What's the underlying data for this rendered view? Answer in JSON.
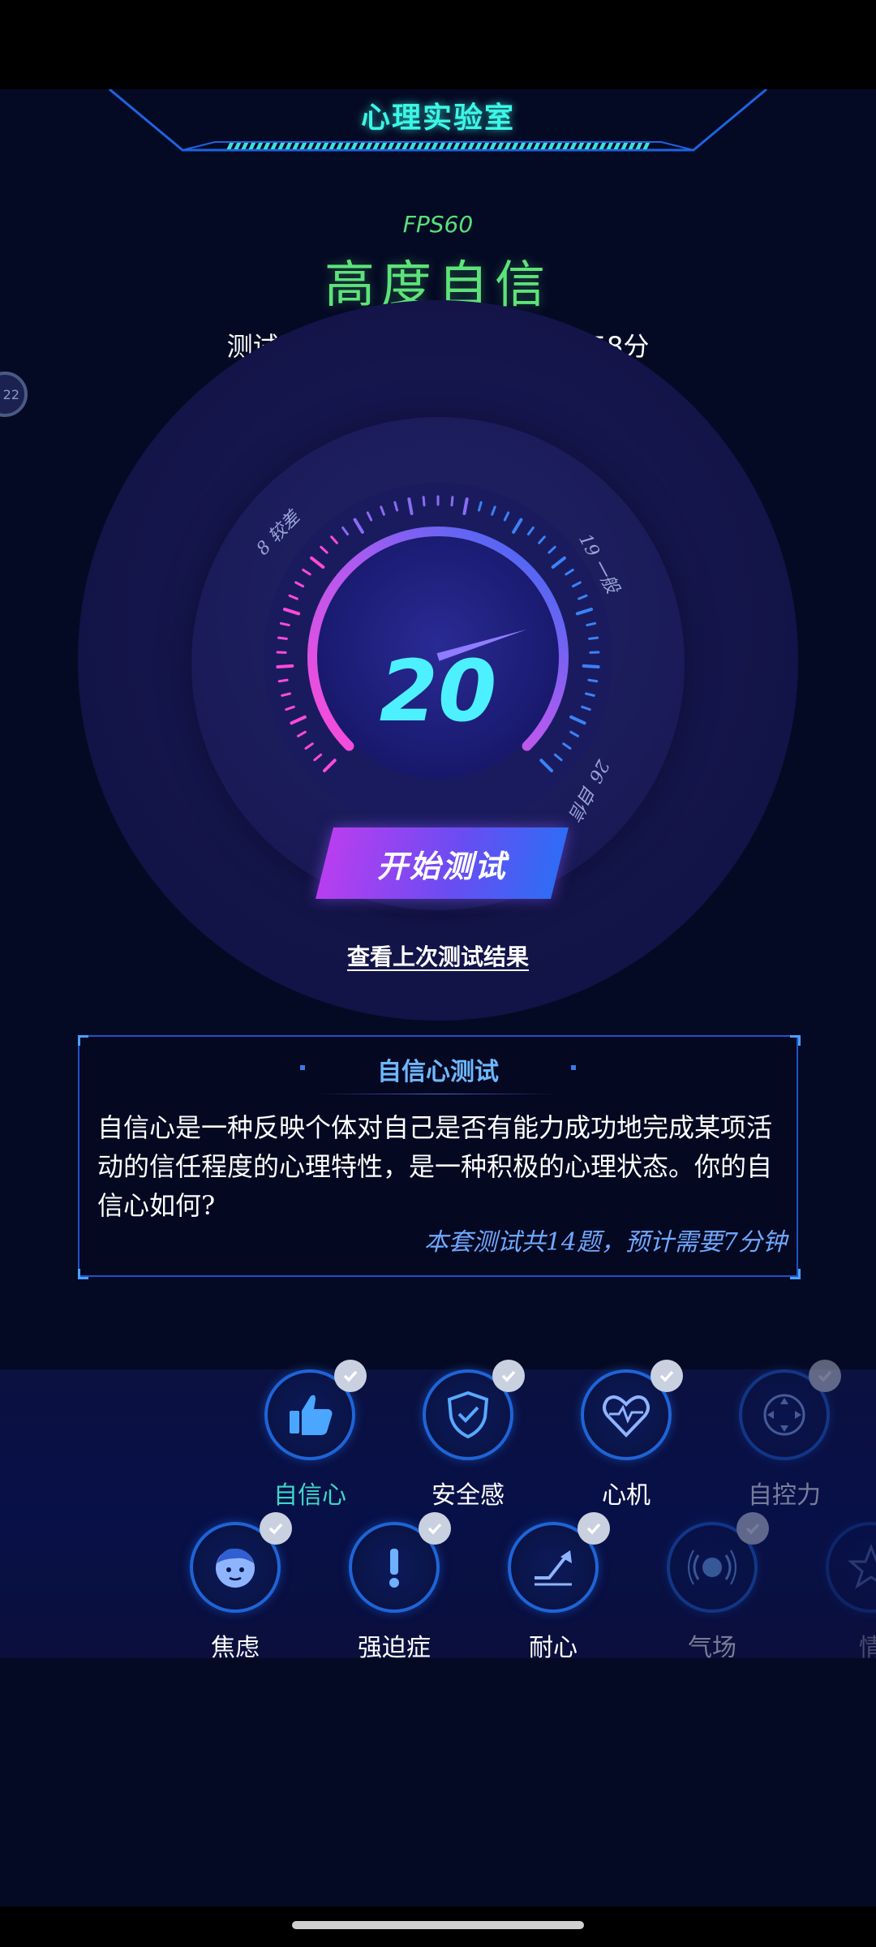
{
  "header": {
    "title": "心理实验室"
  },
  "fps": "FPS60",
  "result": {
    "title": "高度自信",
    "date": "测试于 2024年02月15日 00时58分"
  },
  "gauge": {
    "value": "20",
    "min": 0,
    "max": 26,
    "labels": [
      {
        "num": "8",
        "text": "较差"
      },
      {
        "num": "19",
        "text": "一般"
      },
      {
        "num": "26",
        "text": "自信"
      }
    ],
    "colors": {
      "arc_start": "#ff4ad8",
      "arc_end": "#2f6cf5",
      "value": "#4df0ff"
    }
  },
  "actions": {
    "start": "开始测试",
    "last_result": "查看上次测试结果"
  },
  "side_bubble": "22",
  "description": {
    "title": "自信心测试",
    "text": "自信心是一种反映个体对自己是否有能力成功地完成某项活动的信任程度的心理特性，是一种积极的心理状态。你的自信心如何?",
    "note": "本套测试共14题，预计需要7分钟"
  },
  "tests": {
    "row1": [
      {
        "label": "自信心",
        "icon": "thumbs-up-icon",
        "active": true
      },
      {
        "label": "安全感",
        "icon": "shield-check-icon"
      },
      {
        "label": "心机",
        "icon": "heart-pulse-icon"
      },
      {
        "label": "自控力",
        "icon": "direction-pad-icon"
      }
    ],
    "row2": [
      {
        "label": "焦虑",
        "icon": "face-icon"
      },
      {
        "label": "强迫症",
        "icon": "exclamation-icon"
      },
      {
        "label": "耐心",
        "icon": "growth-arrow-icon"
      },
      {
        "label": "气场",
        "icon": "aura-icon"
      },
      {
        "label": "情",
        "icon": "star-icon"
      }
    ]
  }
}
